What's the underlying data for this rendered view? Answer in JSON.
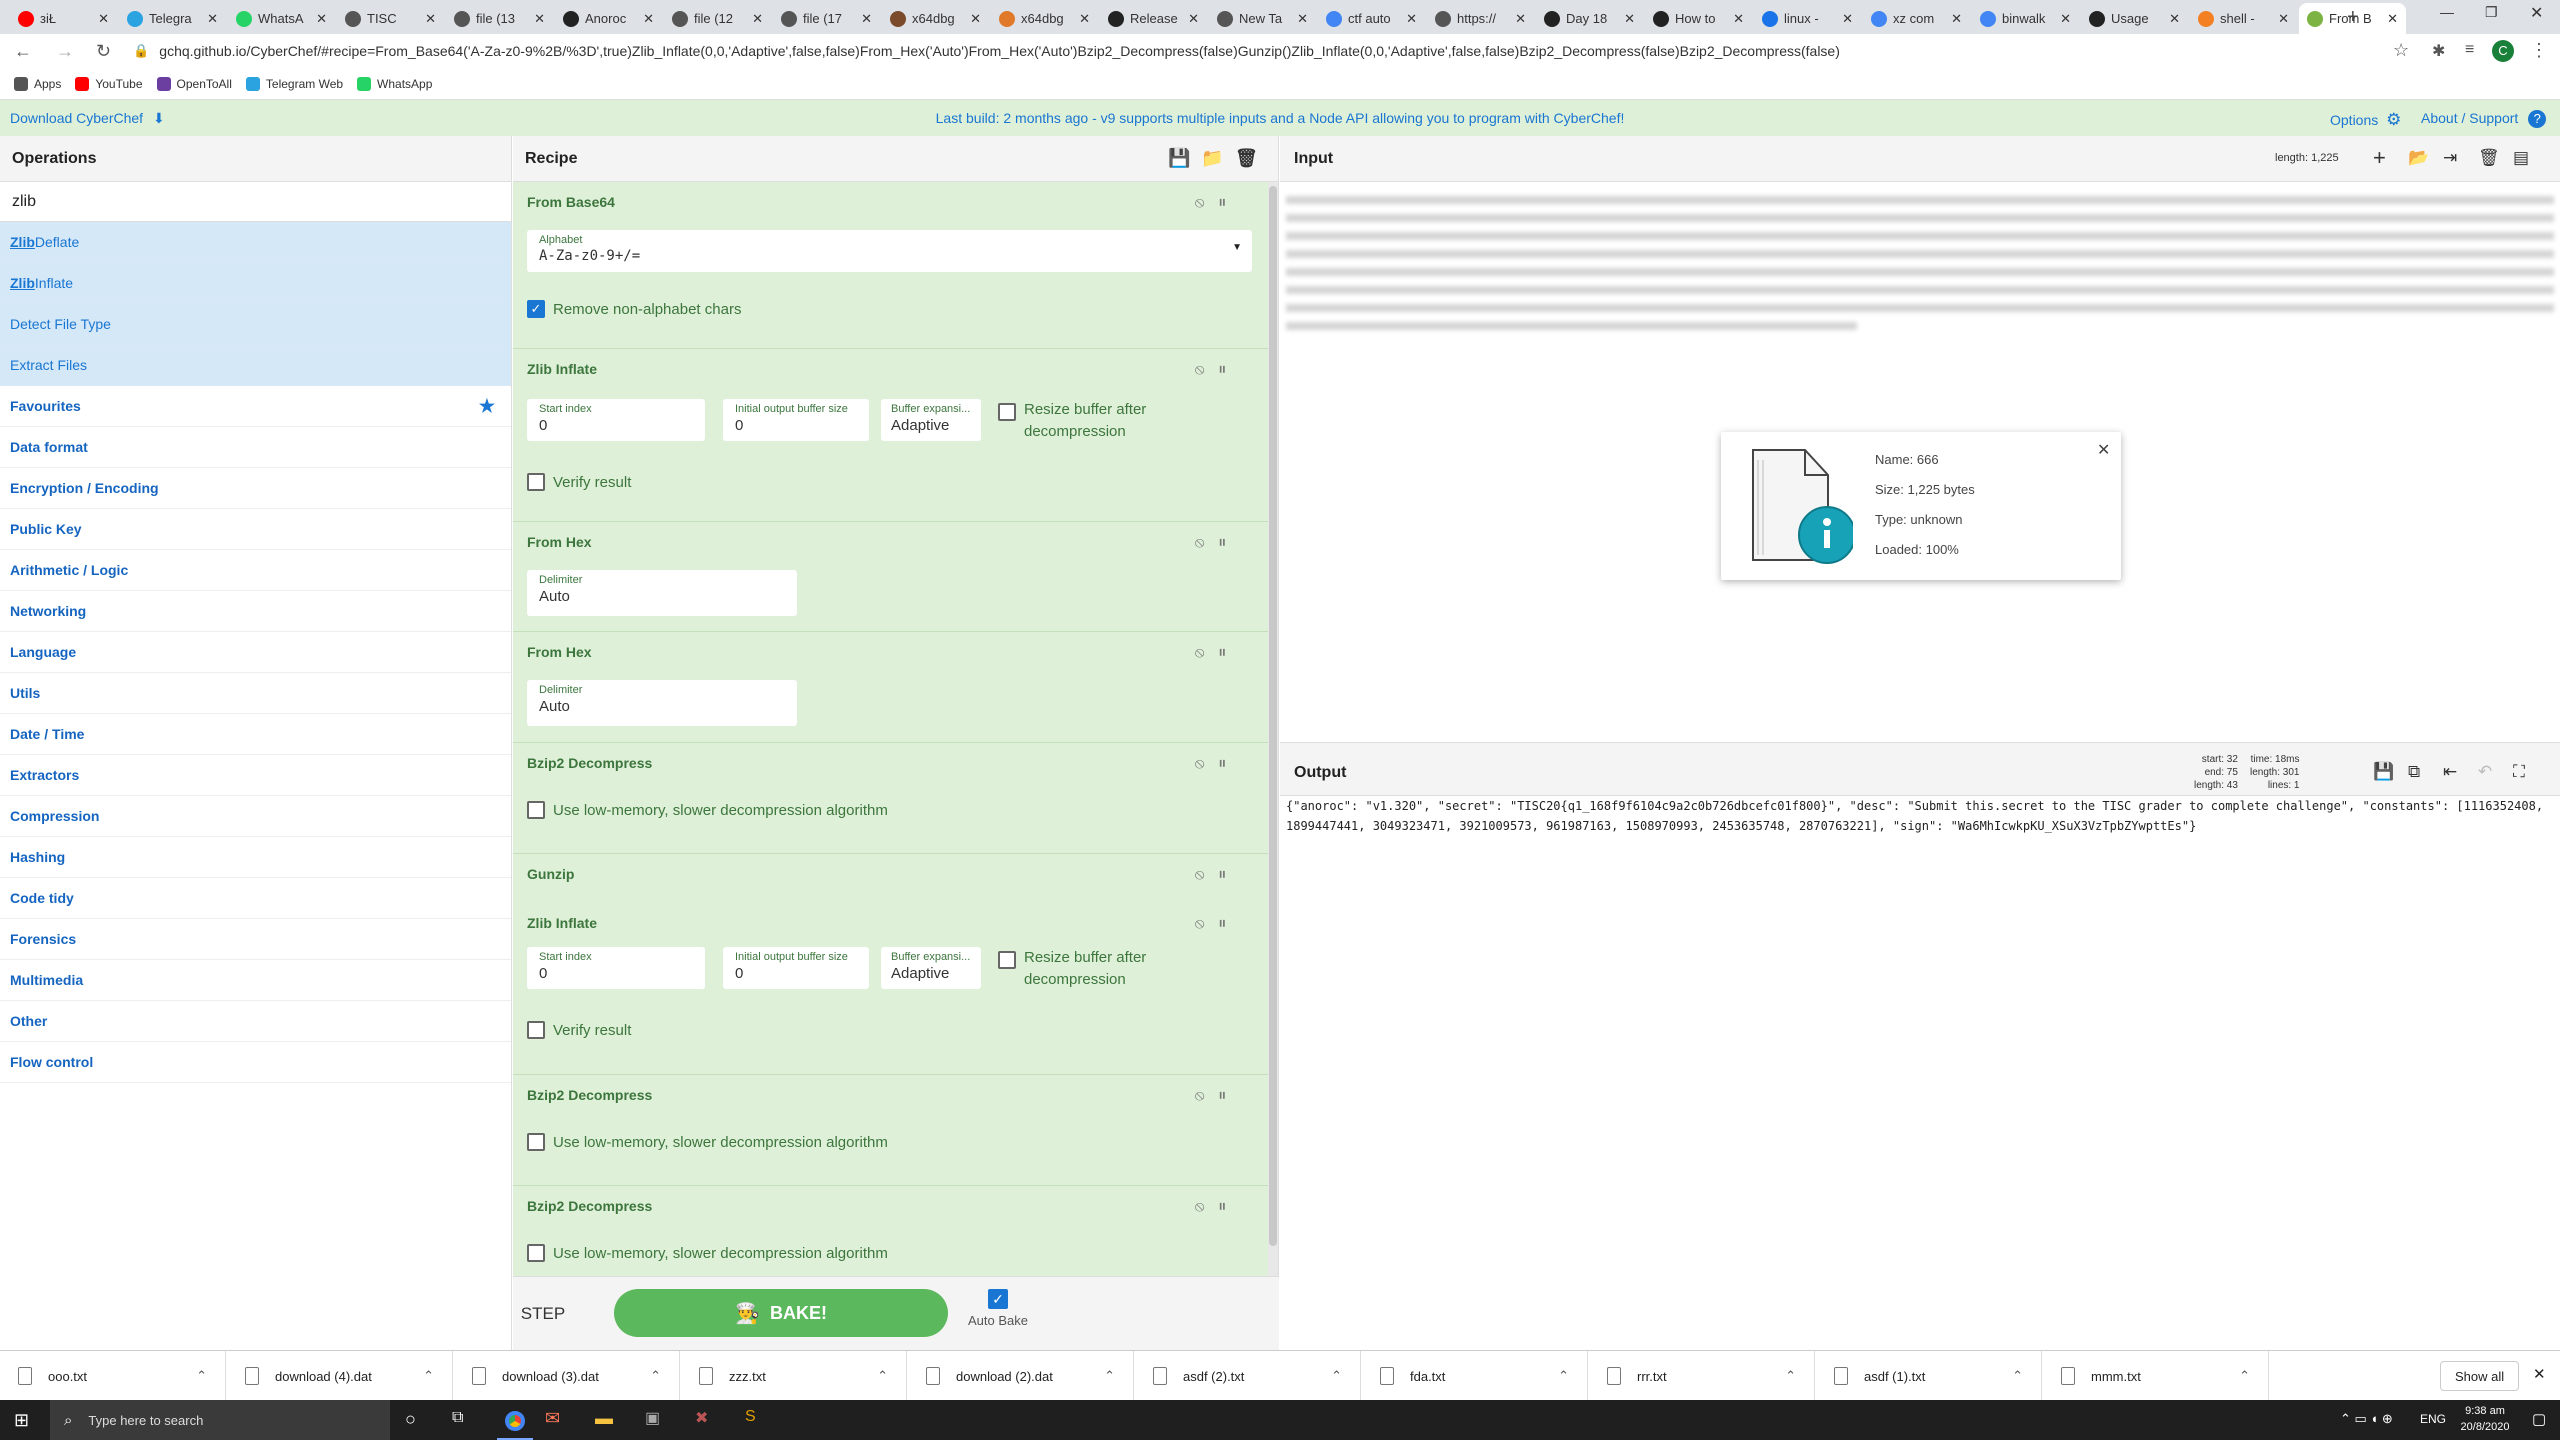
{
  "browser": {
    "tabs": [
      {
        "label": "ᴈiŁ",
        "color": "#ff0000"
      },
      {
        "label": "Telegra",
        "color": "#2aa3e0"
      },
      {
        "label": "WhatsA",
        "color": "#25d366"
      },
      {
        "label": "TISC",
        "color": "#555555"
      },
      {
        "label": "file (13",
        "color": "#555555"
      },
      {
        "label": "Anoroc",
        "color": "#222222"
      },
      {
        "label": "file (12",
        "color": "#555555"
      },
      {
        "label": "file (17",
        "color": "#555555"
      },
      {
        "label": "x64dbg",
        "color": "#7a4a2a"
      },
      {
        "label": "x64dbg",
        "color": "#e07a2a"
      },
      {
        "label": "Release",
        "color": "#222222"
      },
      {
        "label": "New Ta",
        "color": "#555555"
      },
      {
        "label": "ctf auto",
        "color": "#4285f4"
      },
      {
        "label": "https://",
        "color": "#555555"
      },
      {
        "label": "Day 18",
        "color": "#222222"
      },
      {
        "label": "How to",
        "color": "#222222"
      },
      {
        "label": "linux -",
        "color": "#1a73e8"
      },
      {
        "label": "xz com",
        "color": "#4285f4"
      },
      {
        "label": "binwalk",
        "color": "#4285f4"
      },
      {
        "label": "Usage",
        "color": "#222222"
      },
      {
        "label": "shell -",
        "color": "#f48024"
      },
      {
        "label": "From B",
        "color": "#7cb342"
      }
    ],
    "url": "gchq.github.io/CyberChef/#recipe=From_Base64('A-Za-z0-9%2B/%3D',true)Zlib_Inflate(0,0,'Adaptive',false,false)From_Hex('Auto')From_Hex('Auto')Bzip2_Decompress(false)Gunzip()Zlib_Inflate(0,0,'Adaptive',false,false)Bzip2_Decompress(false)Bzip2_Decompress(false)",
    "profile_initial": "C",
    "bookmarks": [
      {
        "label": "Apps",
        "color": "#555555"
      },
      {
        "label": "YouTube",
        "color": "#ff0000"
      },
      {
        "label": "OpenToAll",
        "color": "#6a3fa0"
      },
      {
        "label": "Telegram Web",
        "color": "#2aa3e0"
      },
      {
        "label": "WhatsApp",
        "color": "#25d366"
      }
    ]
  },
  "banner": {
    "download": "Download CyberChef",
    "message": "Last build: 2 months ago - v9 supports multiple inputs and a Node API allowing you to program with CyberChef!",
    "options": "Options",
    "about": "About / Support"
  },
  "operations": {
    "title": "Operations",
    "search": "zlib",
    "results": [
      {
        "hl": "Zlib",
        "rest": " Deflate"
      },
      {
        "hl": "Zlib",
        "rest": " Inflate"
      },
      {
        "hl": "",
        "rest": "Detect File Type"
      },
      {
        "hl": "",
        "rest": "Extract Files"
      }
    ],
    "categories": [
      "Favourites",
      "Data format",
      "Encryption / Encoding",
      "Public Key",
      "Arithmetic / Logic",
      "Networking",
      "Language",
      "Utils",
      "Date / Time",
      "Extractors",
      "Compression",
      "Hashing",
      "Code tidy",
      "Forensics",
      "Multimedia",
      "Other",
      "Flow control"
    ]
  },
  "recipe": {
    "title": "Recipe",
    "from_base64": {
      "title": "From Base64",
      "alphabet_label": "Alphabet",
      "alphabet": "A-Za-z0-9+/=",
      "remove": "Remove non-alphabet chars"
    },
    "zlib1": {
      "title": "Zlib Inflate",
      "start_label": "Start index",
      "start": "0",
      "buf_label": "Initial output buffer size",
      "buf": "0",
      "exp_label": "Buffer expansi...",
      "exp": "Adaptive",
      "resize": "Resize buffer after decompression",
      "verify": "Verify result"
    },
    "hex1": {
      "title": "From Hex",
      "delim_label": "Delimiter",
      "delim": "Auto"
    },
    "hex2": {
      "title": "From Hex",
      "delim_label": "Delimiter",
      "delim": "Auto"
    },
    "bz1": {
      "title": "Bzip2 Decompress",
      "opt": "Use low-memory, slower decompression algorithm"
    },
    "gunzip": {
      "title": "Gunzip"
    },
    "zlib2": {
      "title": "Zlib Inflate",
      "start_label": "Start index",
      "start": "0",
      "buf_label": "Initial output buffer size",
      "buf": "0",
      "exp_label": "Buffer expansi...",
      "exp": "Adaptive",
      "resize": "Resize buffer after decompression",
      "verify": "Verify result"
    },
    "bz2": {
      "title": "Bzip2 Decompress",
      "opt": "Use low-memory, slower decompression algorithm"
    },
    "bz3": {
      "title": "Bzip2 Decompress",
      "opt": "Use low-memory, slower decompression algorithm"
    },
    "step": "STEP",
    "bake": "BAKE!",
    "autobake": "Auto Bake"
  },
  "input": {
    "title": "Input",
    "length_label": "length:",
    "length": "1,225",
    "file": {
      "name": "Name: 666",
      "size": "Size: 1,225 bytes",
      "type": "Type: unknown",
      "loaded": "Loaded: 100%"
    }
  },
  "output": {
    "title": "Output",
    "stats": {
      "start": "start: 32",
      "end": "end: 75",
      "length": "length: 43",
      "time": "time: 18ms",
      "olength": "length: 301",
      "lines": "lines: 1"
    },
    "text": "{\"anoroc\": \"v1.320\", \"secret\": \"TISC20{q1_168f9f6104c9a2c0b726dbcefc01f800}\", \"desc\": \"Submit this.secret to the TISC grader to complete challenge\", \"constants\": [1116352408, 1899447441, 3049323471, 3921009573, 961987163, 1508970993, 2453635748, 2870763221], \"sign\": \"Wa6MhIcwkpKU_XSuX3VzTpbZYwpttEs\"}"
  },
  "downloads": {
    "items": [
      "ooo.txt",
      "download (4).dat",
      "download (3).dat",
      "zzz.txt",
      "download (2).dat",
      "asdf (2).txt",
      "fda.txt",
      "rrr.txt",
      "asdf (1).txt",
      "mmm.txt"
    ],
    "show_all": "Show all"
  },
  "taskbar": {
    "search": "Type here to search",
    "lang": "ENG",
    "time": "9:38 am",
    "date": "20/8/2020"
  }
}
